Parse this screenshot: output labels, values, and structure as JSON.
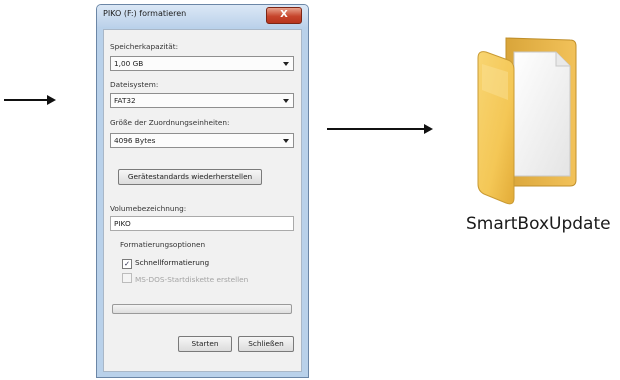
{
  "dialog": {
    "title": "PIKO (F:) formatieren",
    "close_label": "X",
    "capacity_label": "Speicherkapazität:",
    "capacity_value": "1,00 GB",
    "filesystem_label": "Dateisystem:",
    "filesystem_value": "FAT32",
    "alloc_label": "Größe der Zuordnungseinheiten:",
    "alloc_value": "4096 Bytes",
    "restore_button": "Gerätestandards wiederherstellen",
    "volume_label": "Volumebezeichnung:",
    "volume_value": "PIKO",
    "options_label": "Formatierungsoptionen",
    "quick_format_label": "Schnellformatierung",
    "quick_format_checked": true,
    "msdos_label": "MS-DOS-Startdiskette erstellen",
    "msdos_checked": false,
    "progress": 0,
    "start_button": "Starten",
    "close_button": "Schließen"
  },
  "folder": {
    "icon": "folder-icon",
    "label": "SmartBoxUpdate"
  },
  "colors": {
    "window_frame": "#b9d1ea",
    "close_button": "#c6452c",
    "folder_yellow": "#f4c756"
  }
}
